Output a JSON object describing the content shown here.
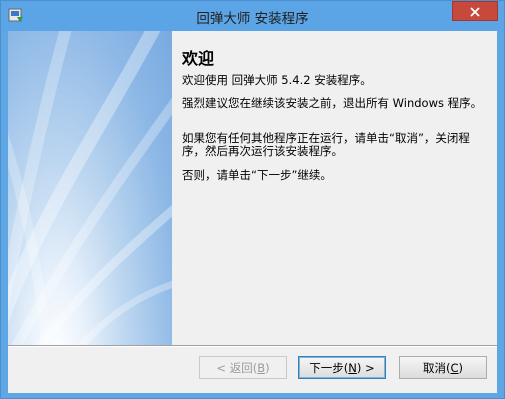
{
  "window": {
    "title": "回弹大师 安装程序",
    "icon": "installer-icon",
    "close_icon": "close-icon"
  },
  "content": {
    "heading": "欢迎",
    "paragraphs": [
      "欢迎使用 回弹大师 5.4.2 安装程序。",
      "强烈建议您在继续该安装之前，退出所有 Windows 程序。",
      "如果您有任何其他程序正在运行，请单击“取消”，关闭程序，然后再次运行该安装程序。",
      "否则，请单击“下一步”继续。"
    ]
  },
  "buttons": {
    "back": {
      "label": "< 返回(",
      "key": "B",
      "suffix": ")"
    },
    "next": {
      "label": "下一步(",
      "key": "N",
      "suffix": ") >"
    },
    "cancel": {
      "label": "取消(",
      "key": "C",
      "suffix": ")"
    }
  }
}
